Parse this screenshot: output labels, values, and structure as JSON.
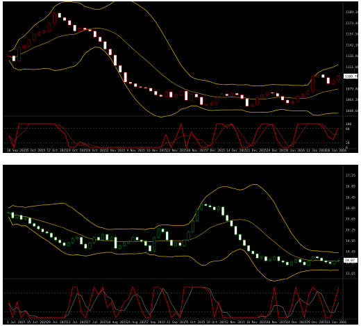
{
  "colors": {
    "background": "#000000",
    "text": "#c8c8c8",
    "band": "#c8a000",
    "bullish": "#ffffff",
    "bearish": "#ffffff",
    "gold_accent": "#cc0000",
    "silver_accent": "#00b000",
    "stoch_main": "#d00000",
    "stoch_signal": "#8a1a1a",
    "silver_stoch_main": "#c00000",
    "silver_stoch_signal": "#6a6a6a",
    "price_box_bg": "#ffffff",
    "price_box_text": "#000000",
    "grid": "#1a1a1a"
  },
  "gold": {
    "header": "GOLD,Daily  1088.80 1104.40 1092.30 1100.70",
    "price_axis": [
      "1189.30",
      "1173.40",
      "1157.50",
      "1142.20",
      "1126.60",
      "1111.00",
      "1095.30",
      "1079.80",
      "1064.20",
      "1048.60"
    ],
    "current_price": "1100.70",
    "stoch_header": "Stoch(5,3,3) 67.2675 66.0503",
    "stoch_axis": [
      "100",
      "80",
      "20",
      "0"
    ],
    "date_axis": [
      "28 Sep 2015",
      "5 Oct 2015",
      "12 Oct 2015",
      "19 Oct 2015",
      "26 Oct 2015",
      "2 Nov 2015",
      "9 Nov 2015",
      "16 Nov 2015",
      "23 Nov 2015",
      "30 Nov 2015",
      "7 Dec 2015",
      "14 Dec 2015",
      "21 Dec 2015",
      "29 Dec 2015",
      "6 Jan 2016",
      "13 Jan 2016",
      "20 Jan 2016"
    ]
  },
  "silver": {
    "header": "SILVER,Daily  14.22 14.28 13.87 14.07",
    "price_axis": [
      "17.25",
      "16.85",
      "16.45",
      "16.05",
      "15.65",
      "15.25",
      "14.85",
      "14.45",
      "14.05",
      "13.65"
    ],
    "current_price": "14.07",
    "stoch_header": "Stoch(5,3,3) 71.5447 59.7651",
    "date_axis": [
      "1 Jul 2015",
      "15 Jul 2015",
      "29 Jul 2015",
      "13 Jul 2015",
      "27 Jul 2015",
      "10 Aug 2015",
      "24 Aug 2015",
      "7 Sep 2015",
      "21 Sep 2015",
      "5 Oct 2015",
      "19 Oct 2015",
      "2 Nov 2015",
      "16 Nov 2015",
      "30 Nov 2015",
      "14 Dec 2015",
      "29 Dec 2015",
      "13 Jan 2016"
    ]
  },
  "chart_data": [
    {
      "type": "candlestick",
      "symbol": "GOLD,Daily",
      "ylim": [
        1048.6,
        1189.3
      ],
      "series": [
        {
          "name": "close",
          "values": [
            1127,
            1120,
            1138,
            1140,
            1148,
            1155,
            1158,
            1160,
            1170,
            1184,
            1178,
            1174,
            1168,
            1160,
            1164,
            1162,
            1160,
            1152,
            1146,
            1136,
            1128,
            1114,
            1105,
            1092,
            1090,
            1086,
            1085,
            1084,
            1080,
            1075,
            1073,
            1079,
            1072,
            1075,
            1080,
            1068,
            1076,
            1072,
            1062,
            1062,
            1064,
            1072,
            1076,
            1074,
            1077,
            1075,
            1070,
            1060,
            1062,
            1071,
            1075,
            1078,
            1077,
            1073,
            1068,
            1064,
            1066,
            1073,
            1076,
            1080,
            1100,
            1102,
            1098,
            1090,
            1094,
            1100
          ]
        }
      ]
    },
    {
      "type": "candlestick",
      "symbol": "SILVER,Daily",
      "ylim": [
        13.45,
        17.25
      ],
      "series": [
        {
          "name": "close",
          "values": [
            15.8,
            15.6,
            15.7,
            15.55,
            15.6,
            15.4,
            15.3,
            15.2,
            15.1,
            15.05,
            14.9,
            14.8,
            14.7,
            14.6,
            14.7,
            14.85,
            14.9,
            14.65,
            14.5,
            14.7,
            14.9,
            14.8,
            15.0,
            14.8,
            14.9,
            14.5,
            14.6,
            14.7,
            14.75,
            14.9,
            14.8,
            14.75,
            14.6,
            14.4,
            14.9,
            15.2,
            15.1,
            14.8,
            14.6,
            14.7,
            14.6,
            14.8,
            15.1,
            15.5,
            15.9,
            16.1,
            16.05,
            16.0,
            15.9,
            16.0,
            15.7,
            15.5,
            15.3,
            15.0,
            14.8,
            14.6,
            14.4,
            14.3,
            14.15,
            14.2,
            14.05,
            14.1,
            14.2,
            14.05,
            14.0,
            13.9,
            14.0,
            14.1,
            14.0,
            13.9,
            14.05,
            14.2,
            14.15,
            14.05,
            14.0,
            13.95,
            14.05,
            14.07
          ]
        }
      ]
    }
  ]
}
